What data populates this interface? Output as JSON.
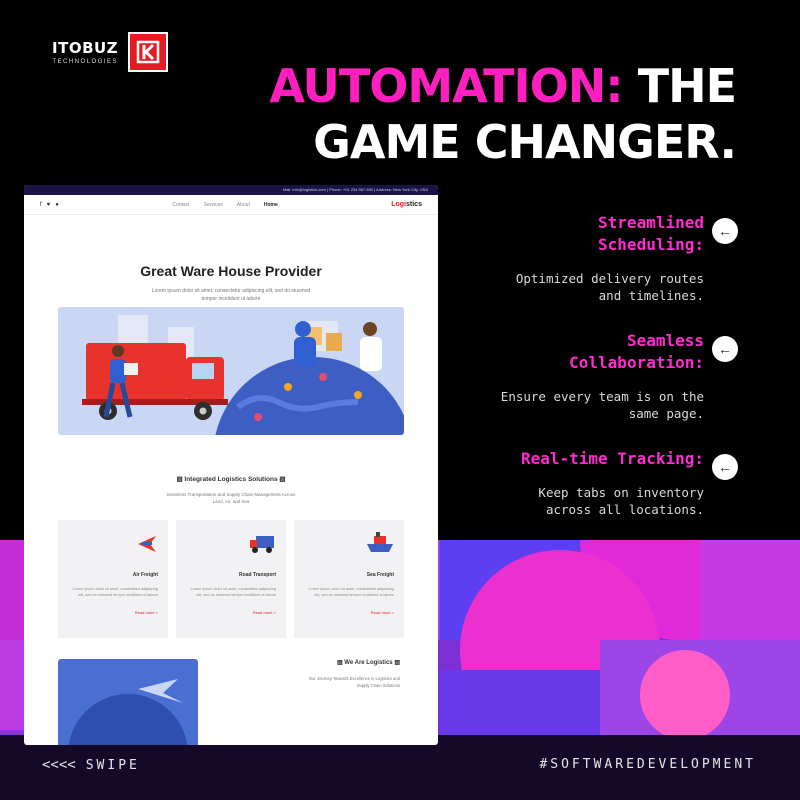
{
  "brand": {
    "name": "ITOBUZ",
    "sub": "TECHNOLOGIES",
    "mark": "K",
    "color": "#e51b24"
  },
  "headline": {
    "pink": "AUTOMATION:",
    "white1": "THE",
    "white2": "GAME CHANGER."
  },
  "features": [
    {
      "title": "Streamlined Scheduling:",
      "desc": "Optimized delivery routes and timelines.",
      "icon": "arrow-left-icon"
    },
    {
      "title": "Seamless Collaboration:",
      "desc": "Ensure every team is on the same page.",
      "icon": "arrow-left-icon"
    },
    {
      "title": "Real-time Tracking:",
      "desc": "Keep tabs on inventory across all locations.",
      "icon": "arrow-left-icon"
    }
  ],
  "site": {
    "topbar": "Mail: info@logistics.com   |   Phone: +01 234 567 890   |   Address: New York City, USA",
    "logo_main": "Logi",
    "logo_accent": "stics",
    "nav": [
      "Home",
      "About",
      "Services",
      "Contact"
    ],
    "hero_title": "Great Ware House Provider",
    "hero_sub": "Lorem ipsum dolor sit amet, consectetur adipiscing elit, sed do eiusmod tempor incididunt ut labore",
    "section_title": "Integrated Logistics Solutions",
    "section_sub": "Seamless Transportation and Supply Chain Management Across Land, Air, and Sea",
    "cards": [
      {
        "title": "Sea Freight",
        "desc": "Lorem ipsum dolor sit amet, consectetur adipiscing elit, sed do eiusmod tempor incididunt ut labore",
        "link": "Read more >"
      },
      {
        "title": "Road Transport",
        "desc": "Lorem ipsum dolor sit amet, consectetur adipiscing elit, sed do eiusmod tempor incididunt ut labore",
        "link": "Read more >"
      },
      {
        "title": "Air Freight",
        "desc": "Lorem ipsum dolor sit amet, consectetur adipiscing elit, sed do eiusmod tempor incididunt ut labore",
        "link": "Read more >"
      }
    ],
    "about_title": "We Are Logistics",
    "about_sub": "Our Journey Towards Excellence in Logistics and Supply Chain Solutions"
  },
  "footer": {
    "swipe": "SWIPE",
    "swipe_arrows": "<<<<",
    "hashtag": "#SOFTWAREDEVELOPMENT"
  },
  "colors": {
    "pink": "#ff1fbf",
    "background": "#000000",
    "brand_red": "#e51b24"
  }
}
